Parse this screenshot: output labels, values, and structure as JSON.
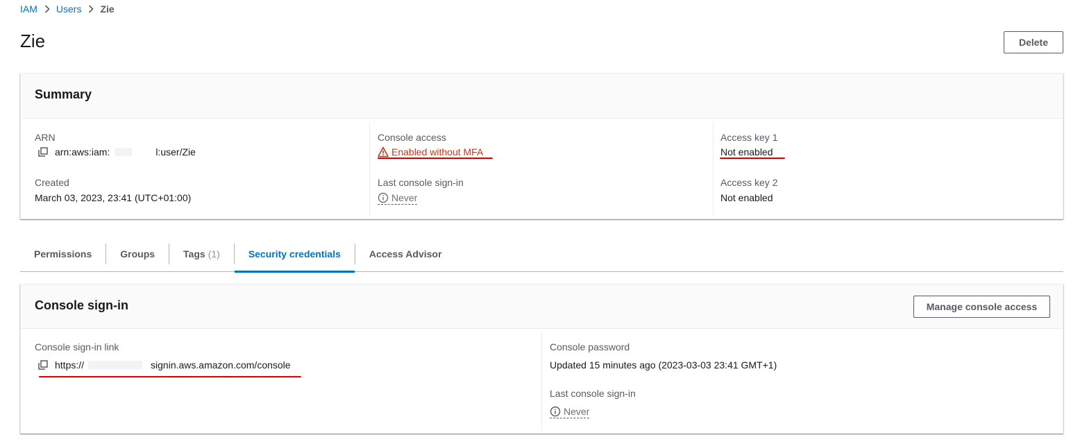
{
  "breadcrumb": {
    "items": [
      {
        "label": "IAM",
        "link": true
      },
      {
        "label": "Users",
        "link": true
      },
      {
        "label": "Zie",
        "link": false
      }
    ]
  },
  "page": {
    "title": "Zie",
    "delete_label": "Delete"
  },
  "summary": {
    "title": "Summary",
    "arn_label": "ARN",
    "arn_prefix": "arn:aws:iam:",
    "arn_suffix": "l:user/Zie",
    "created_label": "Created",
    "created_value": "March 03, 2023, 23:41 (UTC+01:00)",
    "console_access_label": "Console access",
    "console_access_value": "Enabled without MFA",
    "last_signin_label": "Last console sign-in",
    "last_signin_value": "Never",
    "access_key1_label": "Access key 1",
    "access_key1_value": "Not enabled",
    "access_key2_label": "Access key 2",
    "access_key2_value": "Not enabled"
  },
  "tabs": [
    {
      "label": "Permissions",
      "count": "",
      "active": false
    },
    {
      "label": "Groups",
      "count": "",
      "active": false
    },
    {
      "label": "Tags",
      "count": "(1)",
      "active": false
    },
    {
      "label": "Security credentials",
      "count": "",
      "active": true
    },
    {
      "label": "Access Advisor",
      "count": "",
      "active": false
    }
  ],
  "console_signin": {
    "title": "Console sign-in",
    "manage_label": "Manage console access",
    "link_label": "Console sign-in link",
    "link_prefix": "https://",
    "link_suffix": "signin.aws.amazon.com/console",
    "password_label": "Console password",
    "password_value": "Updated 15 minutes ago (2023-03-03 23:41 GMT+1)",
    "last_signin_label": "Last console sign-in",
    "last_signin_value": "Never"
  },
  "colors": {
    "link": "#0073bb",
    "warning": "#d13212",
    "annotation_red": "#d40000"
  }
}
